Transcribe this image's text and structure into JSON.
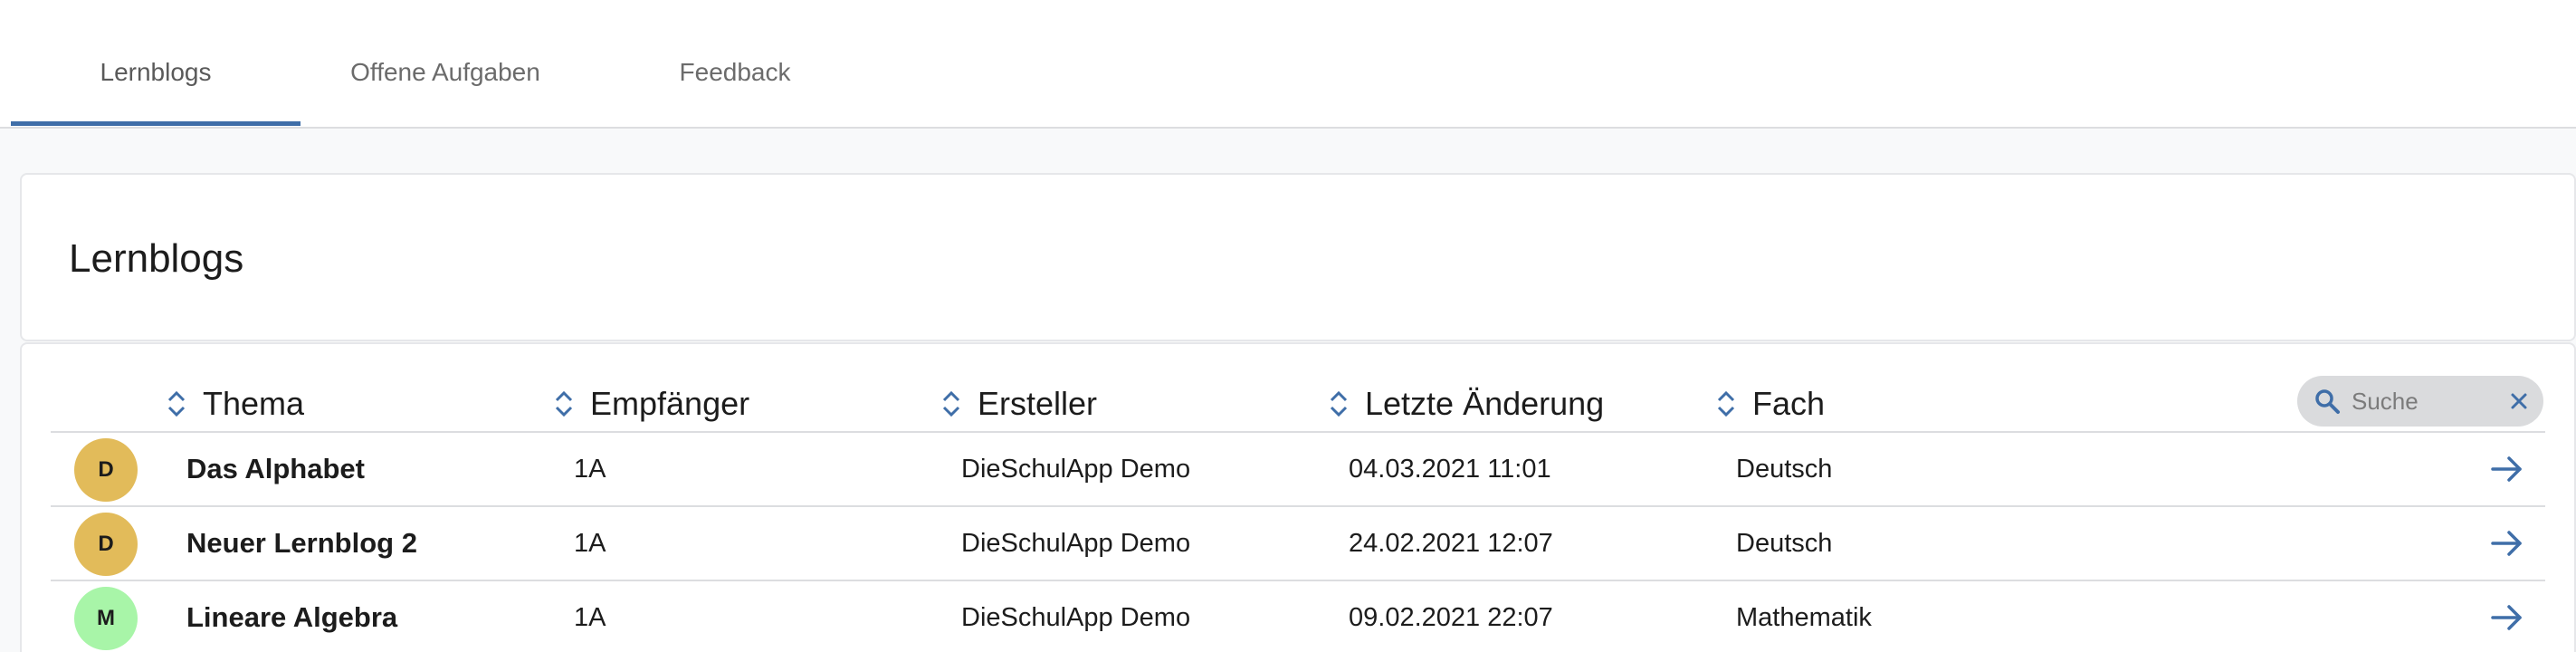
{
  "tabs": [
    {
      "label": "Lernblogs",
      "active": true
    },
    {
      "label": "Offene Aufgaben",
      "active": false
    },
    {
      "label": "Feedback",
      "active": false
    }
  ],
  "page": {
    "title": "Lernblogs"
  },
  "table": {
    "columns": [
      "Thema",
      "Empfänger",
      "Ersteller",
      "Letzte Änderung",
      "Fach"
    ],
    "search": {
      "placeholder": "Suche",
      "value": ""
    },
    "rows": [
      {
        "avatar": "D",
        "avatar_color": "#e2bb5a",
        "thema": "Das Alphabet",
        "empfaenger": "1A",
        "ersteller": "DieSchulApp Demo",
        "letzte_aenderung": "04.03.2021 11:01",
        "fach": "Deutsch"
      },
      {
        "avatar": "D",
        "avatar_color": "#e2bb5a",
        "thema": "Neuer Lernblog 2",
        "empfaenger": "1A",
        "ersteller": "DieSchulApp Demo",
        "letzte_aenderung": "24.02.2021 12:07",
        "fach": "Deutsch"
      },
      {
        "avatar": "M",
        "avatar_color": "#a8f5a8",
        "thema": "Lineare Algebra",
        "empfaenger": "1A",
        "ersteller": "DieSchulApp Demo",
        "letzte_aenderung": "09.02.2021 22:07",
        "fach": "Mathematik"
      }
    ]
  },
  "colors": {
    "accent": "#3f6ea8",
    "divider": "#dcdde0"
  },
  "icons": {
    "sort": "sort-updown-icon",
    "search": "search-icon",
    "clear": "close-icon",
    "open": "arrow-right-icon"
  }
}
